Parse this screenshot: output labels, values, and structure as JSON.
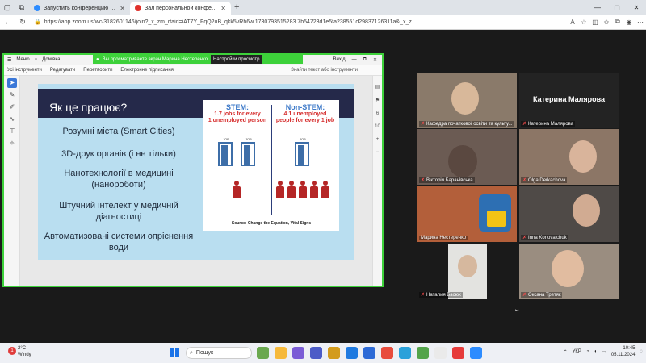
{
  "browser": {
    "tabs": [
      {
        "label": "Запустить конференцию - Zoom",
        "active": false,
        "fav_color": "#2d8cff"
      },
      {
        "label": "Зал персональной конфер...",
        "active": true,
        "fav_color": "#e0312c"
      }
    ],
    "url": "https://app.zoom.us/wc/3182601146/join?_x_zm_rtaid=iAT7Y_FqQ2uB_qkk5vRh6w.1730793515283.7b54723d1e5fa238551d29837126311a&_x_z..."
  },
  "pdf": {
    "menu": "Меню",
    "home": "Домівка",
    "tools": [
      "Усі інструменти",
      "Редагувати",
      "Перетворити",
      "Електронне підписання"
    ],
    "search_placeholder": "Знайти текст або інструменти",
    "exit": "Вихід",
    "page_numbers": [
      "6",
      "10"
    ]
  },
  "share_banner": {
    "text": "Вы просматриваете экран  Марина Нестеренко",
    "settings": "Настройки просмотр"
  },
  "slide": {
    "title": "Як це працює?",
    "bullets": [
      "Розумні міста (Smart Cities)",
      "3D-друк органів (і не тільки)",
      "Нанотехнології в медицині (нанороботи)",
      "Штучний інтелект у медичній діагностиці",
      "Автоматизовані системи опріснення води"
    ],
    "infographic": {
      "stem_title": "STEM:",
      "stem_line1": "1.7 jobs for every",
      "stem_line2": "1 unemployed person",
      "nonstem_title": "Non-STEM:",
      "nonstem_line1": "4.1 unemployed",
      "nonstem_line2": "people for every 1 job",
      "job_label": "JOB",
      "source": "Source: Change the Equation, Vital Signs"
    }
  },
  "participants": [
    {
      "name": "Кафедра початкової освіти та культу...",
      "bg": "#8a7a6a",
      "face": "#d8b89a"
    },
    {
      "name": "Катерина Малярова",
      "bg": "#232323",
      "face": null,
      "bigname": "Катерина Малярова"
    },
    {
      "name": "Вікторія Баранівська",
      "bg": "#6b5b53",
      "face": "#c7a38a"
    },
    {
      "name": "Olga Derkachova",
      "bg": "#8c7666",
      "face": "#d9b49b"
    },
    {
      "name": "Марина Нестеренко",
      "bg": "#b35f3a",
      "face": null
    },
    {
      "name": "Inna Konovalchuk",
      "bg": "#4f4a47",
      "face": "#d1ab92"
    },
    {
      "name": "Наталия Басюк",
      "bg": "#e3e3e0",
      "face": "#d6b89e"
    },
    {
      "name": "Оксана Третяк",
      "bg": "#9a8d80",
      "face": "#e1bca0"
    }
  ],
  "taskbar": {
    "temp": "2°C",
    "weather": "Windy",
    "search": "Пошук",
    "lang": "УКР",
    "time": "10:45",
    "date": "05.11.2024",
    "weather_badge": "1"
  }
}
